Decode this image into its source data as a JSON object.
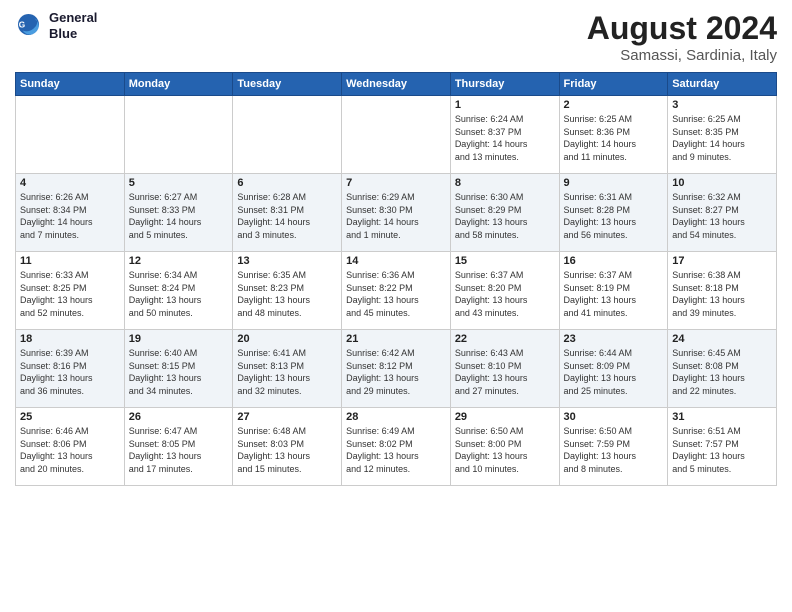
{
  "logo": {
    "line1": "General",
    "line2": "Blue"
  },
  "title": "August 2024",
  "subtitle": "Samassi, Sardinia, Italy",
  "weekdays": [
    "Sunday",
    "Monday",
    "Tuesday",
    "Wednesday",
    "Thursday",
    "Friday",
    "Saturday"
  ],
  "weeks": [
    [
      {
        "day": "",
        "info": ""
      },
      {
        "day": "",
        "info": ""
      },
      {
        "day": "",
        "info": ""
      },
      {
        "day": "",
        "info": ""
      },
      {
        "day": "1",
        "info": "Sunrise: 6:24 AM\nSunset: 8:37 PM\nDaylight: 14 hours\nand 13 minutes."
      },
      {
        "day": "2",
        "info": "Sunrise: 6:25 AM\nSunset: 8:36 PM\nDaylight: 14 hours\nand 11 minutes."
      },
      {
        "day": "3",
        "info": "Sunrise: 6:25 AM\nSunset: 8:35 PM\nDaylight: 14 hours\nand 9 minutes."
      }
    ],
    [
      {
        "day": "4",
        "info": "Sunrise: 6:26 AM\nSunset: 8:34 PM\nDaylight: 14 hours\nand 7 minutes."
      },
      {
        "day": "5",
        "info": "Sunrise: 6:27 AM\nSunset: 8:33 PM\nDaylight: 14 hours\nand 5 minutes."
      },
      {
        "day": "6",
        "info": "Sunrise: 6:28 AM\nSunset: 8:31 PM\nDaylight: 14 hours\nand 3 minutes."
      },
      {
        "day": "7",
        "info": "Sunrise: 6:29 AM\nSunset: 8:30 PM\nDaylight: 14 hours\nand 1 minute."
      },
      {
        "day": "8",
        "info": "Sunrise: 6:30 AM\nSunset: 8:29 PM\nDaylight: 13 hours\nand 58 minutes."
      },
      {
        "day": "9",
        "info": "Sunrise: 6:31 AM\nSunset: 8:28 PM\nDaylight: 13 hours\nand 56 minutes."
      },
      {
        "day": "10",
        "info": "Sunrise: 6:32 AM\nSunset: 8:27 PM\nDaylight: 13 hours\nand 54 minutes."
      }
    ],
    [
      {
        "day": "11",
        "info": "Sunrise: 6:33 AM\nSunset: 8:25 PM\nDaylight: 13 hours\nand 52 minutes."
      },
      {
        "day": "12",
        "info": "Sunrise: 6:34 AM\nSunset: 8:24 PM\nDaylight: 13 hours\nand 50 minutes."
      },
      {
        "day": "13",
        "info": "Sunrise: 6:35 AM\nSunset: 8:23 PM\nDaylight: 13 hours\nand 48 minutes."
      },
      {
        "day": "14",
        "info": "Sunrise: 6:36 AM\nSunset: 8:22 PM\nDaylight: 13 hours\nand 45 minutes."
      },
      {
        "day": "15",
        "info": "Sunrise: 6:37 AM\nSunset: 8:20 PM\nDaylight: 13 hours\nand 43 minutes."
      },
      {
        "day": "16",
        "info": "Sunrise: 6:37 AM\nSunset: 8:19 PM\nDaylight: 13 hours\nand 41 minutes."
      },
      {
        "day": "17",
        "info": "Sunrise: 6:38 AM\nSunset: 8:18 PM\nDaylight: 13 hours\nand 39 minutes."
      }
    ],
    [
      {
        "day": "18",
        "info": "Sunrise: 6:39 AM\nSunset: 8:16 PM\nDaylight: 13 hours\nand 36 minutes."
      },
      {
        "day": "19",
        "info": "Sunrise: 6:40 AM\nSunset: 8:15 PM\nDaylight: 13 hours\nand 34 minutes."
      },
      {
        "day": "20",
        "info": "Sunrise: 6:41 AM\nSunset: 8:13 PM\nDaylight: 13 hours\nand 32 minutes."
      },
      {
        "day": "21",
        "info": "Sunrise: 6:42 AM\nSunset: 8:12 PM\nDaylight: 13 hours\nand 29 minutes."
      },
      {
        "day": "22",
        "info": "Sunrise: 6:43 AM\nSunset: 8:10 PM\nDaylight: 13 hours\nand 27 minutes."
      },
      {
        "day": "23",
        "info": "Sunrise: 6:44 AM\nSunset: 8:09 PM\nDaylight: 13 hours\nand 25 minutes."
      },
      {
        "day": "24",
        "info": "Sunrise: 6:45 AM\nSunset: 8:08 PM\nDaylight: 13 hours\nand 22 minutes."
      }
    ],
    [
      {
        "day": "25",
        "info": "Sunrise: 6:46 AM\nSunset: 8:06 PM\nDaylight: 13 hours\nand 20 minutes."
      },
      {
        "day": "26",
        "info": "Sunrise: 6:47 AM\nSunset: 8:05 PM\nDaylight: 13 hours\nand 17 minutes."
      },
      {
        "day": "27",
        "info": "Sunrise: 6:48 AM\nSunset: 8:03 PM\nDaylight: 13 hours\nand 15 minutes."
      },
      {
        "day": "28",
        "info": "Sunrise: 6:49 AM\nSunset: 8:02 PM\nDaylight: 13 hours\nand 12 minutes."
      },
      {
        "day": "29",
        "info": "Sunrise: 6:50 AM\nSunset: 8:00 PM\nDaylight: 13 hours\nand 10 minutes."
      },
      {
        "day": "30",
        "info": "Sunrise: 6:50 AM\nSunset: 7:59 PM\nDaylight: 13 hours\nand 8 minutes."
      },
      {
        "day": "31",
        "info": "Sunrise: 6:51 AM\nSunset: 7:57 PM\nDaylight: 13 hours\nand 5 minutes."
      }
    ]
  ]
}
